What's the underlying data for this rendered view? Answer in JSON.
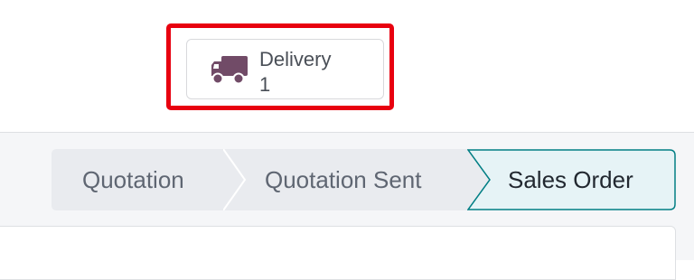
{
  "smart_button": {
    "icon": "truck-icon",
    "label": "Delivery",
    "count": "1"
  },
  "status_bar": {
    "stages": [
      {
        "label": "Quotation",
        "state": "done"
      },
      {
        "label": "Quotation Sent",
        "state": "done"
      },
      {
        "label": "Sales Order",
        "state": "current"
      }
    ]
  },
  "colors": {
    "highlight": "#e8000f",
    "icon": "#714b67",
    "stage_bg": "#e9ebef",
    "current_stage_bg": "#e6f3f6",
    "current_stage_border": "#017e84"
  }
}
